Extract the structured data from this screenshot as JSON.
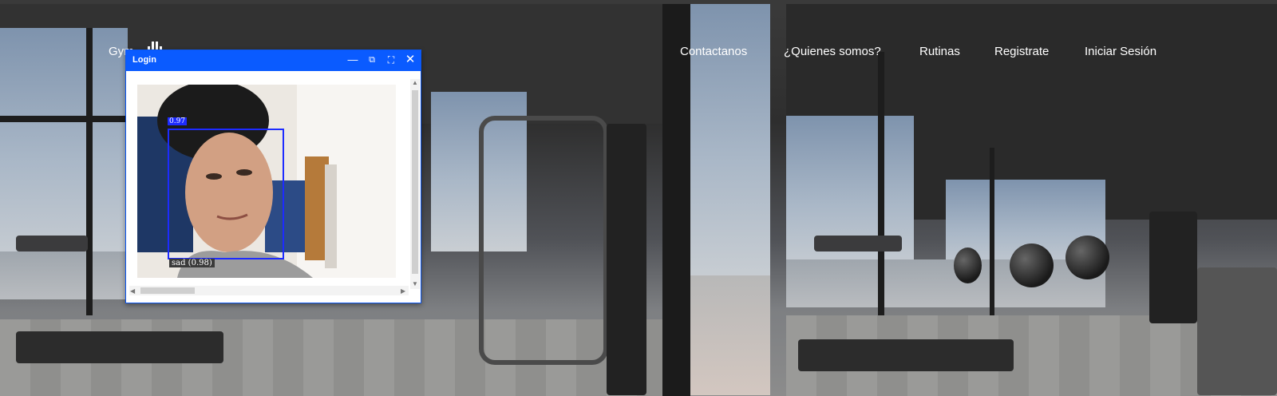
{
  "nav": {
    "brand": "Gym",
    "links": [
      "Contactanos",
      "¿Quienes somos?",
      "Rutinas",
      "Registrate",
      "Iniciar Sesión"
    ]
  },
  "login_window": {
    "title": "Login",
    "controls": [
      "minimize-icon",
      "restore-icon",
      "fullscreen-icon",
      "close-icon"
    ],
    "detection": {
      "confidence": "0.97",
      "emotion_label": "sad (0.98)"
    }
  },
  "colors": {
    "titlebar": "#0a5bff",
    "bbox": "#1d2bff"
  }
}
